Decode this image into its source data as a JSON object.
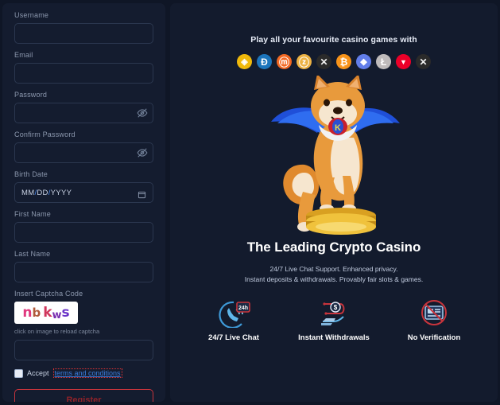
{
  "form": {
    "fields": [
      {
        "label": "Username",
        "name": "username",
        "type": "text",
        "value": "",
        "placeholder": ""
      },
      {
        "label": "Email",
        "name": "email",
        "type": "text",
        "value": "",
        "placeholder": ""
      },
      {
        "label": "Password",
        "name": "password",
        "type": "password",
        "value": "",
        "placeholder": ""
      },
      {
        "label": "Confirm Password",
        "name": "confirm-password",
        "type": "password",
        "value": "",
        "placeholder": ""
      },
      {
        "label": "Birth Date",
        "name": "birth-date",
        "type": "date",
        "value": "MM/DD/YYYY",
        "placeholder": "MM/DD/YYYY"
      },
      {
        "label": "First Name",
        "name": "first-name",
        "type": "text",
        "value": "",
        "placeholder": ""
      },
      {
        "label": "Last Name",
        "name": "last-name",
        "type": "text",
        "value": "",
        "placeholder": ""
      }
    ],
    "captcha": {
      "label": "Insert Captcha Code",
      "code": "nbkws",
      "chars": [
        "n",
        "b",
        "k",
        "w",
        "s"
      ],
      "hint": "click on image to reload captcha",
      "input_value": "",
      "input_placeholder": ""
    },
    "terms": {
      "accept_label": "Accept",
      "link_label": "terms and conditions",
      "checked": false
    },
    "submit_label": "Register",
    "date_parts": {
      "mm": "MM",
      "dd": "DD",
      "yyyy": "YYYY",
      "separator": "/"
    }
  },
  "promo": {
    "tagline": "Play all your favourite casino games with",
    "coins": [
      {
        "name": "binance-coin-icon",
        "symbol": "◈",
        "bg": "#f0b90b",
        "fg": "#ffffff",
        "broken": false
      },
      {
        "name": "dash-coin-icon",
        "symbol": "Ð",
        "bg": "#1c75bc",
        "fg": "#ffffff",
        "broken": false
      },
      {
        "name": "monero-coin-icon",
        "symbol": "ⓜ",
        "bg": "#f26822",
        "fg": "#ffffff",
        "broken": false
      },
      {
        "name": "zcash-coin-icon",
        "symbol": "ⓩ",
        "bg": "#ecb244",
        "fg": "#ffffff",
        "broken": false
      },
      {
        "name": "broken-image-icon",
        "symbol": "✕",
        "bg": "#2a2a2a",
        "fg": "#f0f0f0",
        "broken": true
      },
      {
        "name": "bitcoin-coin-icon",
        "symbol": "₿",
        "bg": "#f7931a",
        "fg": "#ffffff",
        "broken": false
      },
      {
        "name": "ethereum-coin-icon",
        "symbol": "◆",
        "bg": "#627eea",
        "fg": "#ffffff",
        "broken": false
      },
      {
        "name": "litecoin-coin-icon",
        "symbol": "Ł",
        "bg": "#bfbbbb",
        "fg": "#ffffff",
        "broken": false
      },
      {
        "name": "tron-coin-icon",
        "symbol": "▼",
        "bg": "#eb0029",
        "fg": "#ffffff",
        "broken": false
      },
      {
        "name": "broken-image-icon",
        "symbol": "✕",
        "bg": "#2a2a2a",
        "fg": "#f0f0f0",
        "broken": true
      }
    ],
    "mascot_alt": "shiba-inu-superhero-on-gold-coins",
    "title": "The Leading Crypto Casino",
    "subtitle_line1": "24/7 Live Chat Support. Enhanced privacy.",
    "subtitle_line2": "Instant deposits & withdrawals. Provably fair slots & games.",
    "features": [
      {
        "name": "live-chat",
        "icon": "phone-24h-icon",
        "label": "24/7 Live Chat",
        "badge": "24h"
      },
      {
        "name": "instant-withdrawals",
        "icon": "hand-dollar-icon",
        "label": "Instant Withdrawals",
        "badge": "$"
      },
      {
        "name": "no-verification",
        "icon": "no-id-card-icon",
        "label": "No Verification",
        "badge": ""
      }
    ]
  },
  "colors": {
    "page_bg": "#0f1626",
    "panel_bg": "#141c2f",
    "input_border": "#2b374f",
    "label": "#8b97ad",
    "accent_red": "#c8343c",
    "link_blue": "#3b7ddd"
  }
}
